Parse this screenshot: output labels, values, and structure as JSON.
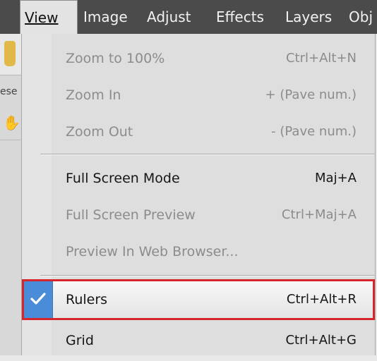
{
  "menubar": {
    "items": [
      {
        "label": "View",
        "active": true
      },
      {
        "label": "Image"
      },
      {
        "label": "Adjust"
      },
      {
        "label": "Effects"
      },
      {
        "label": "Layers"
      },
      {
        "label": "Obj"
      }
    ]
  },
  "background": {
    "partial_label": "ese"
  },
  "view_menu": {
    "items": [
      {
        "label": "Zoom to 100%",
        "shortcut": "Ctrl+Alt+N",
        "enabled": false
      },
      {
        "label": "Zoom In",
        "shortcut": "+ (Pave num.)",
        "enabled": false
      },
      {
        "label": "Zoom Out",
        "shortcut": "- (Pave num.)",
        "enabled": false
      },
      {
        "label": "Full Screen Mode",
        "shortcut": "Maj+A",
        "enabled": true
      },
      {
        "label": "Full Screen Preview",
        "shortcut": "Ctrl+Maj+A",
        "enabled": false
      },
      {
        "label": "Preview In Web Browser...",
        "shortcut": "",
        "enabled": false
      },
      {
        "label": "Rulers",
        "shortcut": "Ctrl+Alt+R",
        "enabled": true,
        "checked": true,
        "highlighted": true
      },
      {
        "label": "Grid",
        "shortcut": "Ctrl+Alt+G",
        "enabled": true
      }
    ]
  },
  "colors": {
    "menubar_bg": "#4b4b4b",
    "menu_bg": "#dedede",
    "highlight_border": "#d6262b",
    "check_bg": "#4a8cd8"
  }
}
